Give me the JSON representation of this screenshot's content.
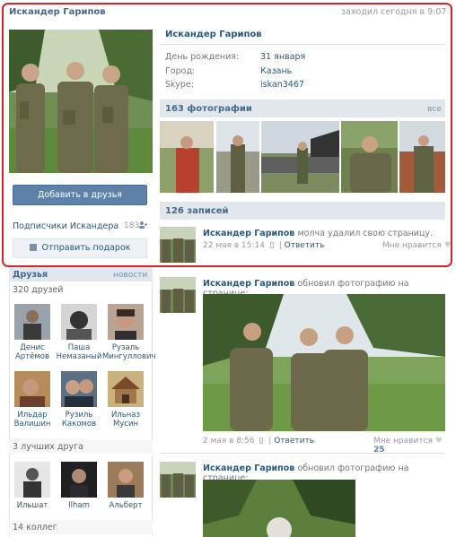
{
  "header": {
    "name": "Искандер Гарипов",
    "online": "заходил сегодня в 9:07"
  },
  "profile": {
    "name": "Искандер Гарипов",
    "info": [
      {
        "label": "День рождения:",
        "value": "31 января"
      },
      {
        "label": "Город:",
        "value": "Казань"
      },
      {
        "label": "Skype:",
        "value": "iskan3467"
      }
    ],
    "add_friend": "Добавить в друзья",
    "subscribers_label": "Подписчики Искандера",
    "subscribers_count": "183",
    "gift": "Отправить подарок"
  },
  "photos": {
    "title": "163 фотографии",
    "all_link": "все"
  },
  "wall": {
    "title": "126 записей",
    "posts": [
      {
        "author": "Искандер Гарипов",
        "text": "молча удалил свою страницу.",
        "date": "22 мая в 15:14",
        "reply": "Ответить",
        "like_text": "Мне нравится",
        "likes": ""
      },
      {
        "author": "Искандер Гарипов",
        "text": "обновил фотографию на странице:",
        "date": "2 мая в 8:56",
        "reply": "Ответить",
        "like_text": "Мне нравится",
        "likes": "25"
      },
      {
        "author": "Искандер Гарипов",
        "text": "обновил фотографию на странице:"
      }
    ]
  },
  "friends": {
    "title": "Друзья",
    "news_link": "новости",
    "count": "320 друзей",
    "list": [
      {
        "first": "Денис",
        "last": "Артёмов"
      },
      {
        "first": "Паша",
        "last": "Немазаный"
      },
      {
        "first": "Рузаль",
        "last": "Мингуллович"
      },
      {
        "first": "Ильдар",
        "last": "Валишин"
      },
      {
        "first": "Рузиль",
        "last": "Какомов"
      },
      {
        "first": "Ильназ",
        "last": "Мусин"
      }
    ],
    "best_title": "3 лучших друга",
    "best": [
      {
        "first": "Ильшат"
      },
      {
        "first": "Ilham"
      },
      {
        "first": "Альберт"
      }
    ],
    "colleagues": "14 коллег"
  }
}
